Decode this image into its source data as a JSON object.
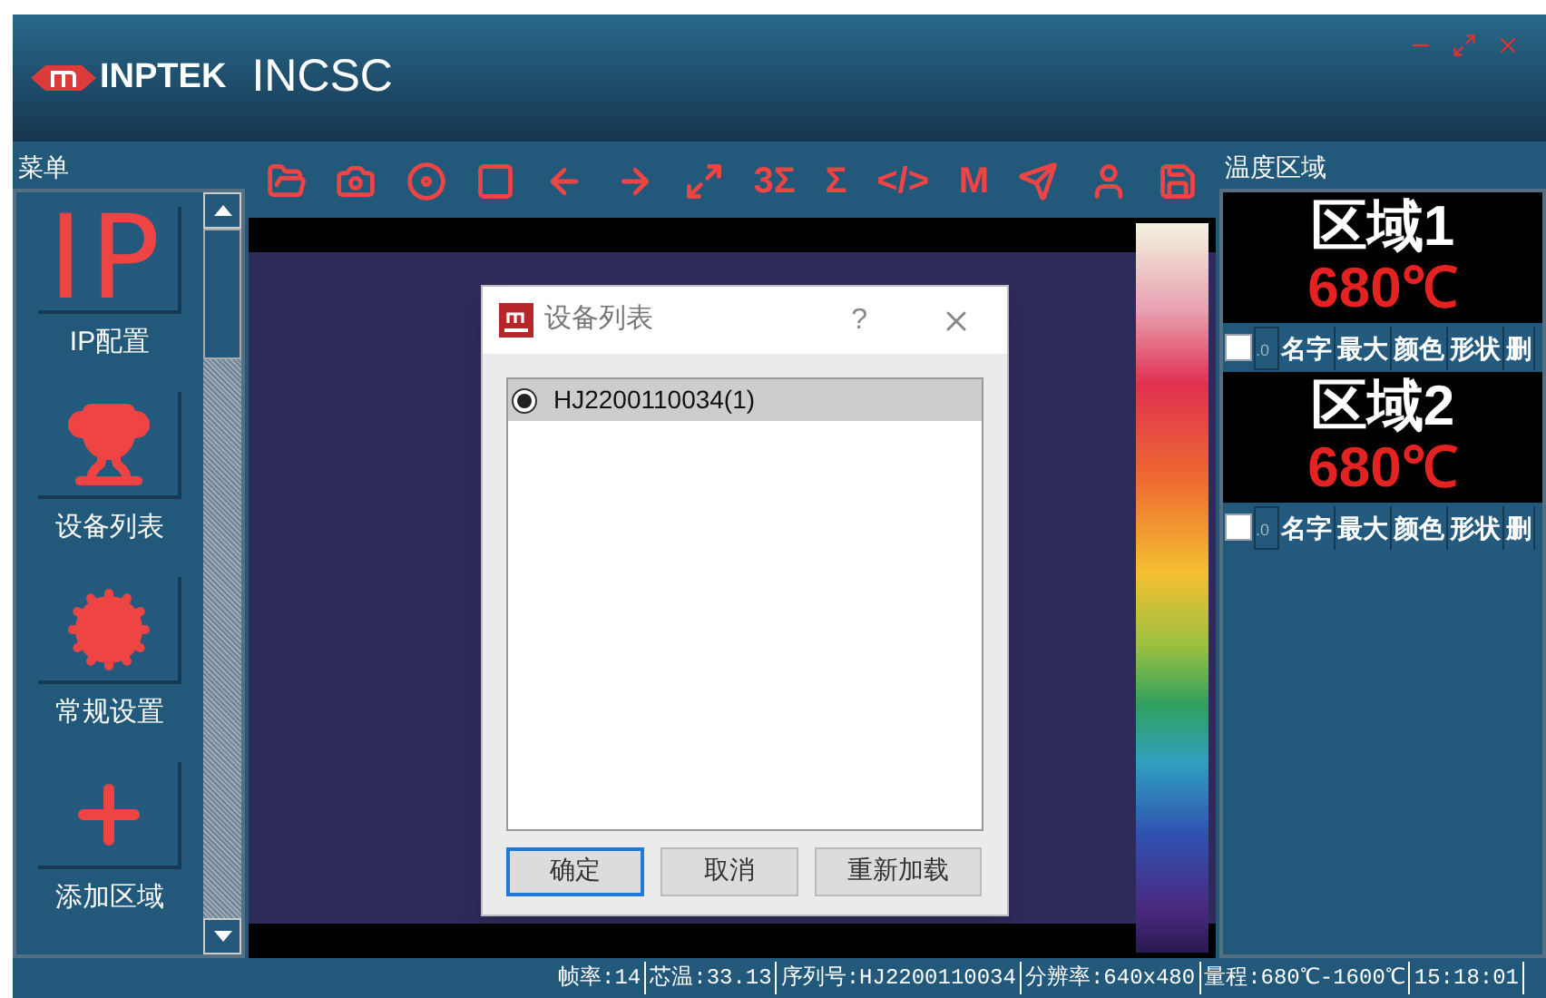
{
  "header": {
    "brand": "INPTEK",
    "title": "INCSC"
  },
  "menu": {
    "title": "菜单",
    "items": [
      {
        "kind": "text",
        "glyph": "IP",
        "label": "IP配置"
      },
      {
        "kind": "trophy",
        "label": "设备列表"
      },
      {
        "kind": "gear",
        "label": "常规设置"
      },
      {
        "kind": "plus",
        "label": "添加区域"
      }
    ]
  },
  "toolbar": [
    {
      "kind": "folder"
    },
    {
      "kind": "camera"
    },
    {
      "kind": "disc"
    },
    {
      "kind": "stop"
    },
    {
      "kind": "back"
    },
    {
      "kind": "forward"
    },
    {
      "kind": "expand"
    },
    {
      "kind": "text",
      "label": "3Σ"
    },
    {
      "kind": "text",
      "label": "Σ"
    },
    {
      "kind": "text",
      "label": "</>"
    },
    {
      "kind": "text",
      "label": "M"
    },
    {
      "kind": "send"
    },
    {
      "kind": "user"
    },
    {
      "kind": "save"
    }
  ],
  "dialog": {
    "title": "设备列表",
    "help": "?",
    "devices": [
      {
        "label": "HJ2200110034(1)",
        "selected": true
      }
    ],
    "buttons": [
      {
        "label": "确定",
        "selected": true
      },
      {
        "label": "取消",
        "selected": false
      },
      {
        "label": "重新加载",
        "selected": false
      }
    ]
  },
  "zones": {
    "title": "温度区域",
    "items": [
      {
        "name": "区域1",
        "temp": "680℃",
        "checked": false,
        "value": ".0",
        "buttons": [
          "名字",
          "最大",
          "颜色",
          "形状",
          "删"
        ]
      },
      {
        "name": "区域2",
        "temp": "680℃",
        "checked": false,
        "value": ".0",
        "buttons": [
          "名字",
          "最大",
          "颜色",
          "形状",
          "删"
        ]
      }
    ]
  },
  "status_bar": [
    "帧率:14",
    "芯温:33.13",
    "序列号:HJ2200110034",
    "分辨率:640x480",
    "量程:680℃-1600℃",
    "15:18:01"
  ]
}
